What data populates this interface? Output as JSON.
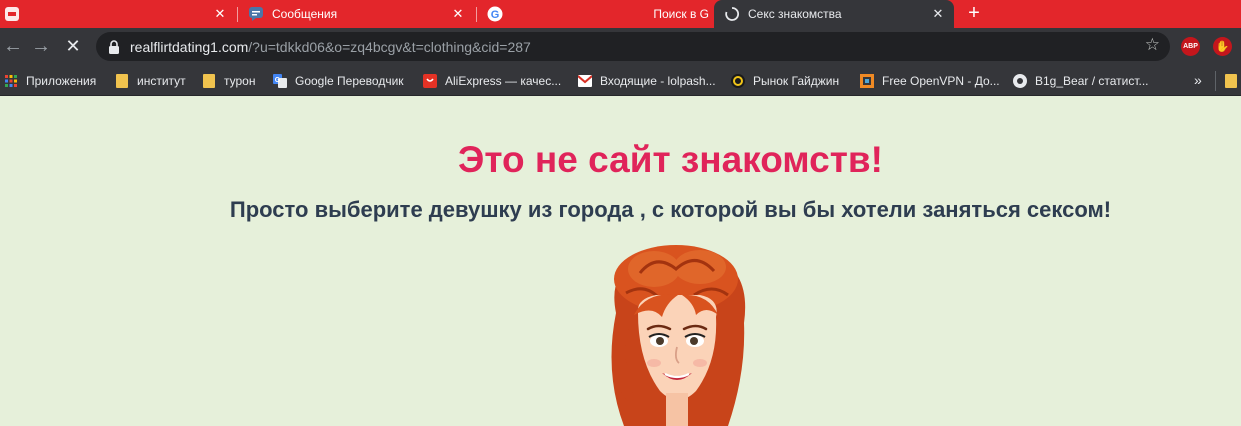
{
  "tabs": [
    {
      "title": "",
      "icon": "vk-icon"
    },
    {
      "title": "Сообщения",
      "icon": "messages-icon"
    },
    {
      "title": "Поиск в G",
      "icon": "google-icon"
    },
    {
      "title": "Секс знакомства",
      "icon": "loading-icon"
    }
  ],
  "toolbar": {
    "url_host": "realflirtdating1.com",
    "url_rest": "/?u=tdkkd06&o=zq4bcgv&t=clothing&cid=287",
    "ext_abp": "ABP"
  },
  "bookmarks": [
    {
      "label": "Приложения",
      "icon": "apps-grid-icon"
    },
    {
      "label": "институт",
      "icon": "folder-icon"
    },
    {
      "label": "турон",
      "icon": "folder-icon"
    },
    {
      "label": "Google Переводчик",
      "icon": "translate-icon"
    },
    {
      "label": "AliExpress — качес...",
      "icon": "aliexpress-icon"
    },
    {
      "label": "Входящие - lolpash...",
      "icon": "gmail-icon"
    },
    {
      "label": "Рынок Гайджин",
      "icon": "gaijin-icon"
    },
    {
      "label": "Free OpenVPN - До...",
      "icon": "openvpn-icon"
    },
    {
      "label": "B1g_Bear / статист...",
      "icon": "stats-icon"
    }
  ],
  "bookmarks_more": "»",
  "page": {
    "headline": "Это не сайт знакомств!",
    "subline": "Просто выберите девушку из города , с которой вы бы хотели заняться сексом!"
  },
  "colors": {
    "tabstrip": "#e3262b",
    "chrome_dark": "#35363a",
    "page_bg": "#e6f0da",
    "headline": "#e0245a",
    "subline": "#2e3d50"
  }
}
